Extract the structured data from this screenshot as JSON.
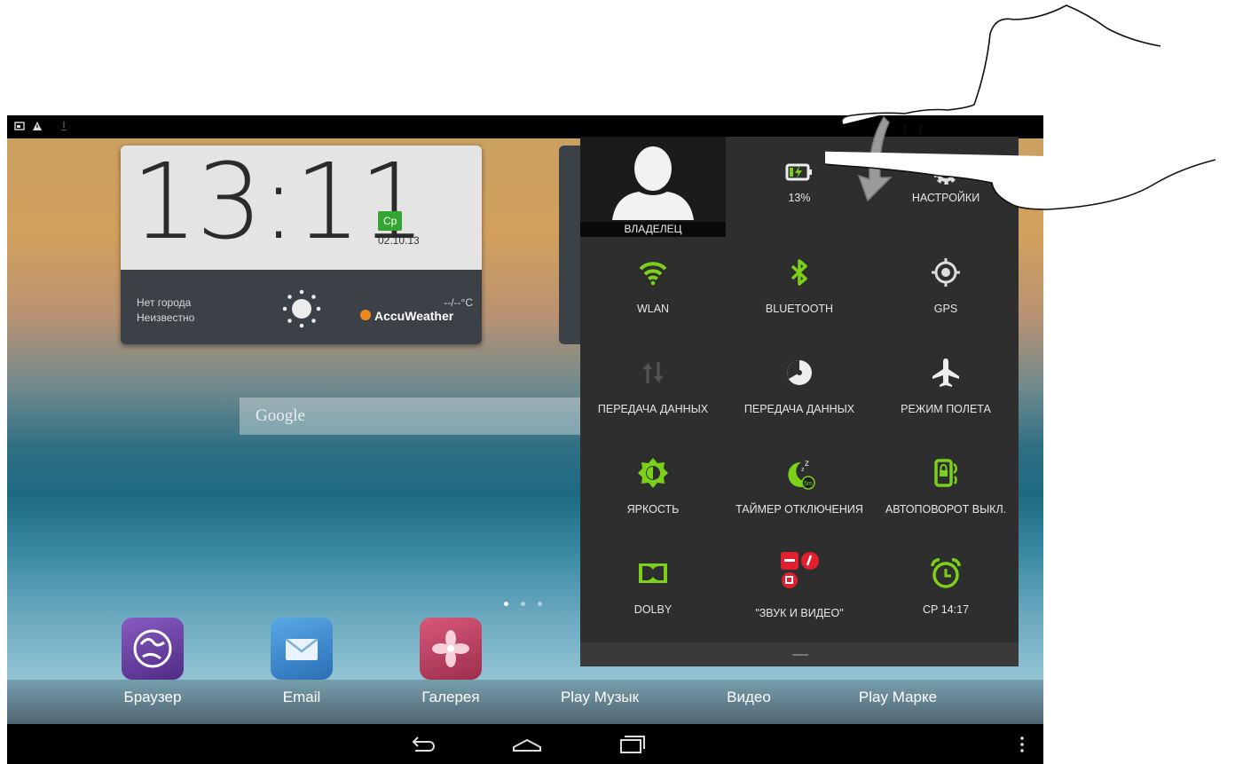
{
  "clock": {
    "time": "13:11",
    "day": "Ср",
    "date": "02.10.13"
  },
  "weather": {
    "city": "Нет города",
    "status": "Неизвестно",
    "temp": "--/--°C",
    "provider": "AccuWeather"
  },
  "search": {
    "label": "Google"
  },
  "home_pages": {
    "count": 3,
    "active": 0
  },
  "dock": [
    {
      "label": "Браузер",
      "icon": "globe-icon",
      "color": "#6b3fa0"
    },
    {
      "label": "Email",
      "icon": "envelope-icon",
      "color": "#3a86c8"
    },
    {
      "label": "Галерея",
      "icon": "flower-icon",
      "color": "#c0415e"
    },
    {
      "label": "Play Музык",
      "icon": "headphones-icon",
      "color": "#e28a1b"
    },
    {
      "label": "Видео",
      "icon": "video-icon",
      "color": "#5a3fa0"
    },
    {
      "label": "Play Марке",
      "icon": "play-store-icon",
      "color": "#3aa84a"
    }
  ],
  "quick_settings": {
    "owner": {
      "label": "ВЛАДЕЛЕЦ",
      "icon": "user-avatar-icon"
    },
    "tiles": [
      {
        "id": "battery",
        "label": "13%",
        "icon": "battery-charging-icon"
      },
      {
        "id": "settings",
        "label": "НАСТРОЙКИ",
        "icon": "gear-icon"
      },
      {
        "id": "wlan",
        "label": "WLAN",
        "icon": "wifi-icon"
      },
      {
        "id": "bluetooth",
        "label": "BLUETOOTH",
        "icon": "bluetooth-icon"
      },
      {
        "id": "gps",
        "label": "GPS",
        "icon": "gps-icon"
      },
      {
        "id": "data-transfer",
        "label": "ПЕРЕДАЧА ДАННЫХ",
        "icon": "data-transfer-icon"
      },
      {
        "id": "data-usage",
        "label": "ПЕРЕДАЧА ДАННЫХ",
        "icon": "data-usage-icon"
      },
      {
        "id": "airplane",
        "label": "РЕЖИМ ПОЛЕТА",
        "icon": "airplane-icon"
      },
      {
        "id": "brightness",
        "label": "ЯРКОСТЬ",
        "icon": "brightness-icon"
      },
      {
        "id": "sleep-timer",
        "label": "ТАЙМЕР ОТКЛЮЧЕНИЯ",
        "icon": "sleep-timer-icon",
        "badge": "5m"
      },
      {
        "id": "autorotate",
        "label": "АВТОПОВОРОТ ВЫКЛ.",
        "icon": "autorotate-icon"
      },
      {
        "id": "dolby",
        "label": "DOLBY",
        "icon": "dolby-icon"
      },
      {
        "id": "sound-video",
        "label": "\"ЗВУК И ВИДЕО\"",
        "icon": "sound-video-icon"
      },
      {
        "id": "alarm",
        "label": "СР 14:17",
        "icon": "alarm-icon"
      }
    ],
    "accent": "#7bd11a"
  },
  "navigation": {
    "back": "back-icon",
    "home": "home-icon",
    "recents": "recents-icon",
    "menu": "overflow-menu-icon"
  }
}
